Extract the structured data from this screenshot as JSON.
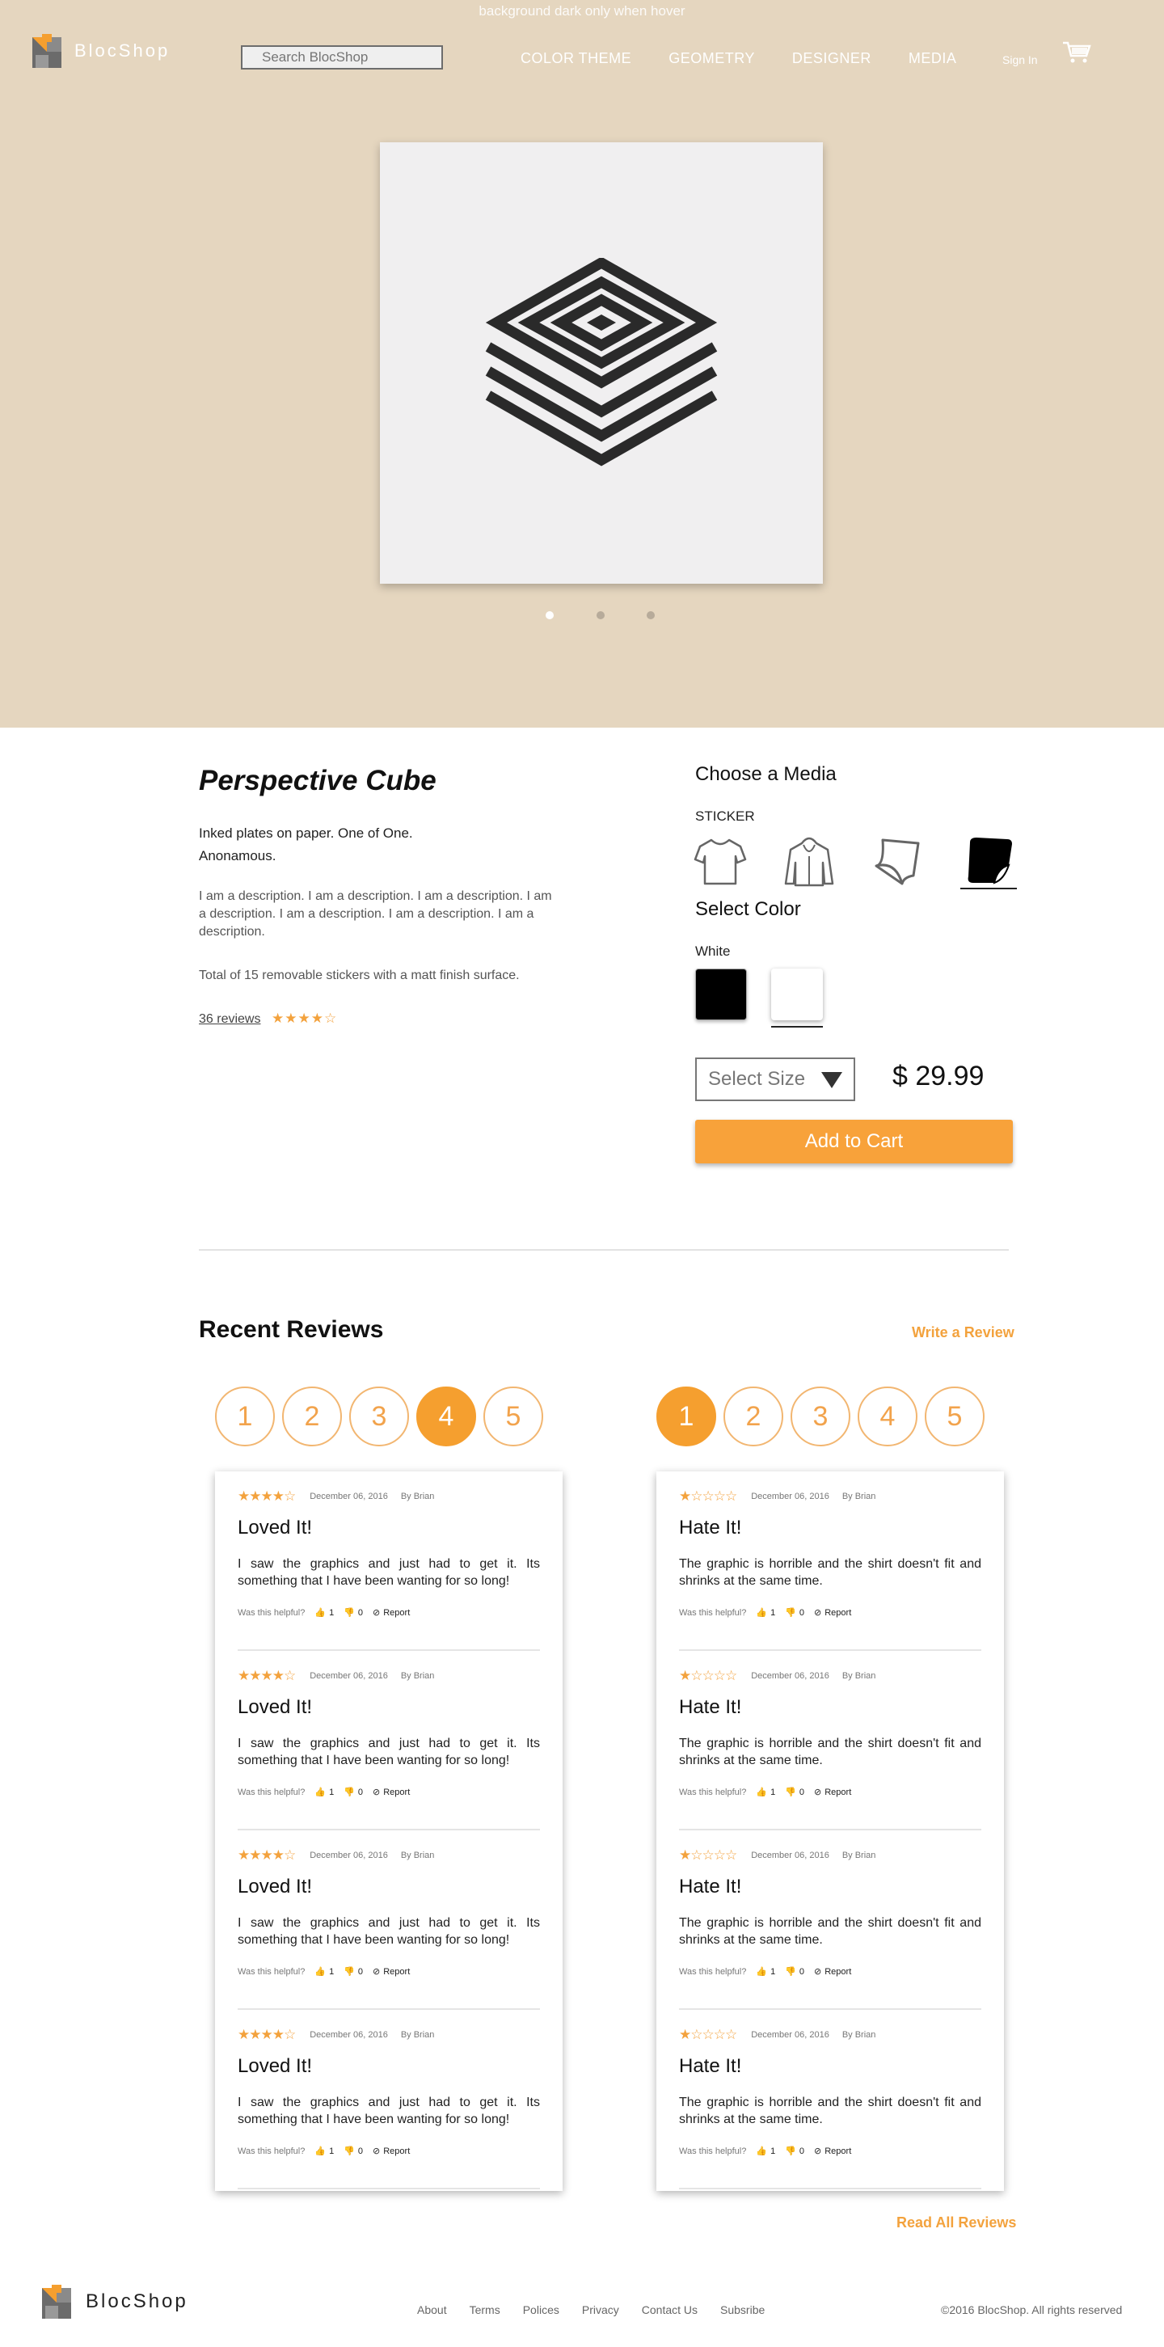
{
  "hero": {
    "note": "background dark only when hover",
    "logo_text": "BlocShop",
    "search_placeholder": "Search BlocShop",
    "nav": [
      "COLOR THEME",
      "GEOMETRY",
      "DESIGNER",
      "MEDIA"
    ],
    "signin": "Sign In",
    "background_color": "#e5d6bf",
    "carousel_dots": 3,
    "carousel_active": 0
  },
  "product": {
    "title": "Perspective Cube",
    "line1": "Inked plates on paper. One of One.",
    "line2": "Anonamous.",
    "description": "I am a description. I am a description. I am a description. I am a description. I am a description. I am a description. I am a description.",
    "finish": "Total of 15 removable stickers with a matt finish surface.",
    "reviews_link": "36 reviews",
    "rating_stars": "★★★★☆"
  },
  "options": {
    "choose_media": "Choose a Media",
    "media_type": "STICKER",
    "media": [
      "t-shirt-icon",
      "hoodie-icon",
      "poster-icon",
      "sticker-icon"
    ],
    "media_selected": 3,
    "select_color": "Select Color",
    "color_name": "White",
    "colors": [
      "#000000",
      "#ffffff"
    ],
    "color_selected": 1,
    "size_label": "Select Size",
    "price": "$ 29.99",
    "add_to_cart": "Add to Cart"
  },
  "reviews": {
    "heading": "Recent Reviews",
    "write_review": "Write a Review",
    "read_all": "Read All Reviews",
    "ratings": [
      "1",
      "2",
      "3",
      "4",
      "5"
    ],
    "left_active": 3,
    "right_active": 0,
    "helpful_label": "Was this helpful?",
    "report_label": "Report",
    "left": [
      {
        "stars": "★★★★☆",
        "date": "December 06, 2016",
        "author": "By Brian",
        "title": "Loved It!",
        "body": "I saw the graphics and just had to get it. Its something that I have been wanting for so long!",
        "up": "1",
        "down": "0"
      },
      {
        "stars": "★★★★☆",
        "date": "December 06, 2016",
        "author": "By Brian",
        "title": "Loved It!",
        "body": "I saw the graphics and just had to get it. Its something that I have been wanting for so long!",
        "up": "1",
        "down": "0"
      },
      {
        "stars": "★★★★☆",
        "date": "December 06, 2016",
        "author": "By Brian",
        "title": "Loved It!",
        "body": "I saw the graphics and just had to get it. Its something that I have been wanting for so long!",
        "up": "1",
        "down": "0"
      },
      {
        "stars": "★★★★☆",
        "date": "December 06, 2016",
        "author": "By Brian",
        "title": "Loved It!",
        "body": "I saw the graphics and just had to get it. Its something that I have been wanting for so long!",
        "up": "1",
        "down": "0"
      }
    ],
    "right": [
      {
        "stars": "★☆☆☆☆",
        "date": "December 06, 2016",
        "author": "By Brian",
        "title": "Hate It!",
        "body": "The graphic is horrible and the shirt doesn't fit and shrinks at the same time.",
        "up": "1",
        "down": "0"
      },
      {
        "stars": "★☆☆☆☆",
        "date": "December 06, 2016",
        "author": "By Brian",
        "title": "Hate It!",
        "body": "The graphic is horrible and the shirt doesn't fit and shrinks at the same time.",
        "up": "1",
        "down": "0"
      },
      {
        "stars": "★☆☆☆☆",
        "date": "December 06, 2016",
        "author": "By Brian",
        "title": "Hate It!",
        "body": "The graphic is horrible and the shirt doesn't fit and shrinks at the same time.",
        "up": "1",
        "down": "0"
      },
      {
        "stars": "★☆☆☆☆",
        "date": "December 06, 2016",
        "author": "By Brian",
        "title": "Hate It!",
        "body": "The graphic is horrible and the shirt doesn't fit and shrinks at the same time.",
        "up": "1",
        "down": "0"
      }
    ]
  },
  "footer": {
    "logo_text": "BlocShop",
    "links": [
      "About",
      "Terms",
      "Polices",
      "Privacy",
      "Contact Us",
      "Subsribe"
    ],
    "copyright": "©2016 BlocShop. All rights reserved"
  },
  "accent_color": "#f59f2f"
}
